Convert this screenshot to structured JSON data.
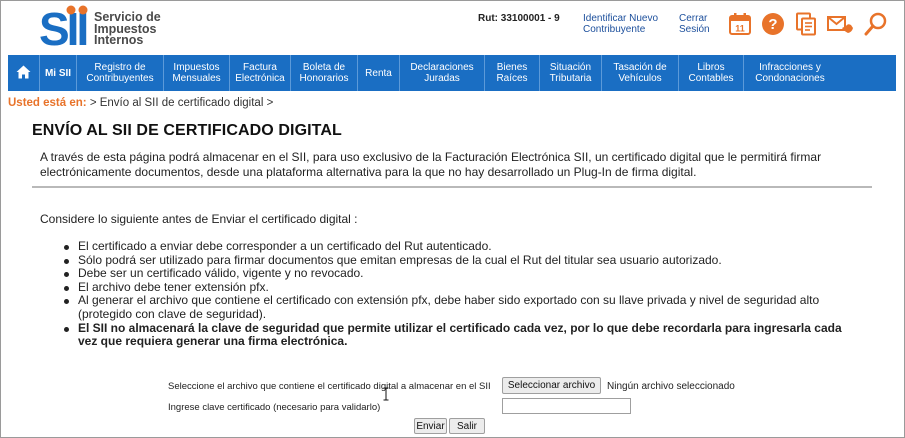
{
  "header": {
    "logo_mark": "SII",
    "logo_lines": [
      "Servicio de",
      "Impuestos",
      "Internos"
    ],
    "rut": "Rut: 33100001 - 9",
    "identificar": [
      "Identificar Nuevo",
      "Contribuyente"
    ],
    "cerrar": [
      "Cerrar",
      "Sesión"
    ],
    "calendar_day": "11",
    "help_glyph": "?",
    "icons": [
      "calendar-icon",
      "help-icon",
      "documents-icon",
      "mail-phone-icon",
      "search-icon"
    ],
    "brand_color": "#1a6ec3",
    "accent_color": "#e8732a"
  },
  "nav": {
    "items": [
      {
        "label": ""
      },
      {
        "label": "Mi SII"
      },
      {
        "label": "Registro de\nContribuyentes"
      },
      {
        "label": "Impuestos\nMensuales"
      },
      {
        "label": "Factura\nElectrónica"
      },
      {
        "label": "Boleta de\nHonorarios"
      },
      {
        "label": "Renta"
      },
      {
        "label": "Declaraciones\nJuradas"
      },
      {
        "label": "Bienes\nRaíces"
      },
      {
        "label": "Situación\nTributaria"
      },
      {
        "label": "Tasación de\nVehículos"
      },
      {
        "label": "Libros\nContables"
      },
      {
        "label": "Infracciones y\nCondonaciones"
      }
    ]
  },
  "breadcrumb": {
    "prefix": "Usted está en:",
    "path": "> Envío al SII de certificado digital >"
  },
  "page": {
    "title": "ENVÍO AL SII DE CERTIFICADO DIGITAL",
    "intro": "A través de esta página podrá almacenar en el SII, para uso exclusivo de la Facturación Electrónica SII, un certificado digital que le permitirá firmar electrónicamente documentos, desde una plataforma alternativa para la que no hay desarrollado un Plug-In de firma digital.",
    "consider": "Considere lo siguiente antes de Enviar el certificado digital :",
    "bullets": [
      "El certificado a enviar debe corresponder a un certificado del Rut autenticado.",
      "Sólo podrá ser utilizado para firmar documentos que emitan empresas de la cual el Rut del titular sea usuario autorizado.",
      "Debe ser un certificado válido, vigente y no revocado.",
      "El archivo debe tener extensión pfx.",
      "Al generar el archivo que contiene el certificado con extensión pfx, debe haber sido exportado con su llave privada y nivel de seguridad alto (protegido con clave de seguridad).",
      "El SII no almacenará la clave de seguridad que permite utilizar el certificado cada vez, por lo que debe recordarla para ingresarla cada vez que requiera generar una firma electrónica."
    ]
  },
  "form": {
    "file_label": "Seleccione el archivo que contiene el certificado digital a almacenar en el SII",
    "file_button": "Seleccionar archivo",
    "file_status": "Ningún archivo seleccionado",
    "password_label": "Ingrese clave certificado (necesario para validarlo)",
    "password_value": "",
    "submit": "Enviar",
    "exit": "Salir"
  }
}
